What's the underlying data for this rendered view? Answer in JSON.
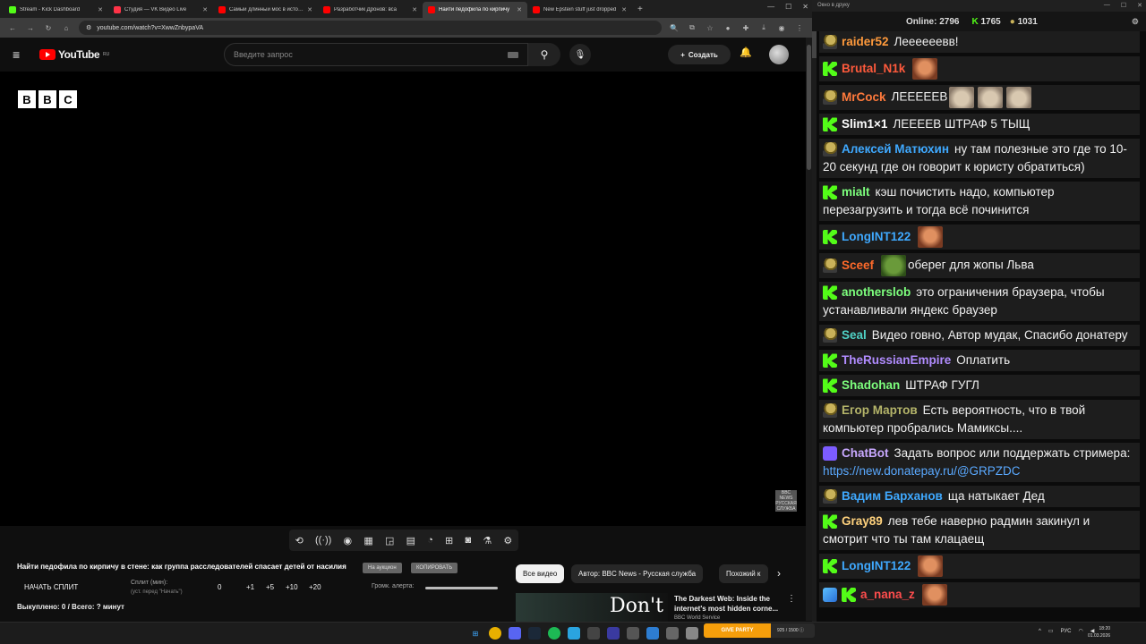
{
  "browser": {
    "tabs": [
      {
        "title": "Stream - Kick Dashboard",
        "color": "#53fc18",
        "active": false
      },
      {
        "title": "Студия — VK Видео Live",
        "color": "#ff3347",
        "active": false
      },
      {
        "title": "Самый длинный мос в истори",
        "color": "#ff0000",
        "active": false
      },
      {
        "title": "Разработчик Дронов: вса",
        "color": "#ff0000",
        "active": false
      },
      {
        "title": "Найти педофила по кирпичу",
        "color": "#ff0000",
        "active": true
      },
      {
        "title": "New Epstein stuff just dropped",
        "color": "#ff0000",
        "active": false
      }
    ],
    "url": "youtube.com/watch?v=XwwZnbypaVA"
  },
  "youtube": {
    "logo_text": "YouTube",
    "region": "RU",
    "search_placeholder": "Введите запрос",
    "create_label": "Создать",
    "video_title": "Найти педофила по кирпичу в стене: как группа расследователей спасает детей от насилия",
    "chip_1": "На аукцион",
    "chip_2": "КОПИРОВАТЬ",
    "bbc_letters": [
      "B",
      "B",
      "C"
    ],
    "watermark": "BBC NEWS РУССКАЯ СЛУЖБА"
  },
  "split": {
    "start_label": "НАЧАТЬ СПЛИТ",
    "min_label": "Сплит (мин):",
    "hint": "(уст. перед \"Начать\")",
    "value": "0",
    "steps": [
      "+1",
      "+5",
      "+10",
      "+20"
    ],
    "alert_label": "Громк. алерта:",
    "bought": "Выкуплено: 0 / Всего: ? минут"
  },
  "related": {
    "chips": [
      "Все видео",
      "Автор: BBC News - Русская служба",
      "Похожий к"
    ],
    "thumb_text": "Don't",
    "title": "The Darkest Web: Inside the internet's most hidden corne...",
    "channel": "BBC World Service"
  },
  "chat": {
    "window_title": "Окно в друку",
    "online_label": "Online:",
    "online": "2796",
    "kick_count": "1765",
    "other_count": "1031",
    "messages": [
      {
        "icon": "d",
        "user": "raider52",
        "color": "#ff9a3c",
        "text": "Леееееевв!"
      },
      {
        "icon": "k",
        "user": "Brutal_N1k",
        "color": "#ff5a3c",
        "text": "",
        "emotes": [
          "e-face"
        ]
      },
      {
        "icon": "d",
        "user": "MrCock",
        "color": "#ff7a3c",
        "text": "ЛЕЕЕЕЕВ",
        "emotes": [
          "e-cat",
          "e-cat",
          "e-cat"
        ]
      },
      {
        "icon": "k",
        "user": "Slim1×1",
        "color": "#ffffff",
        "text": "ЛЕЕЕЕВ ШТРАФ 5 ТЫЩ"
      },
      {
        "icon": "d",
        "user": "Алексей Матюхин",
        "color": "#3fa9ff",
        "text": "ну там полезные это где то 10-20 секунд где он говорит к юристу обратиться)"
      },
      {
        "icon": "k",
        "user": "mialt",
        "color": "#7dff7d",
        "text": "кэш почистить надо, компьютер перезагрузить и тогда всё починится"
      },
      {
        "icon": "k",
        "user": "LongINT122",
        "color": "#3fa9ff",
        "text": "",
        "emotes": [
          "e-face"
        ]
      },
      {
        "icon": "d",
        "user": "Sceef",
        "color": "#ff6a2a",
        "text": "оберег для жопы Льва",
        "emotes": [
          "e-frog"
        ]
      },
      {
        "icon": "k",
        "user": "anotherslob",
        "color": "#7dff7d",
        "text": "это ограничения браузера, чтобы устанавливали яндекс браузер"
      },
      {
        "icon": "d",
        "user": "Seal",
        "color": "#4fd1c5",
        "text": "Видео говно, Автор мудак, Спасибо донатеру"
      },
      {
        "icon": "k",
        "user": "TheRussianEmpire",
        "color": "#b18cff",
        "text": "Оплатить"
      },
      {
        "icon": "k",
        "user": "Shadohan",
        "color": "#7dff7d",
        "text": "ШТРАФ ГУГЛ"
      },
      {
        "icon": "d",
        "user": "Егор Мартов",
        "color": "#b5b56a",
        "text": "Есть вероятность, что в твой компьютер пробрались Мамиксы...."
      },
      {
        "icon": "r",
        "user": "ChatBot",
        "color": "#c8a8ff",
        "text": "Задать вопрос или поддержать стримера:",
        "link": "https://new.donatepay.ru/@GRPZDC"
      },
      {
        "icon": "d",
        "user": "Вадим Барханов",
        "color": "#3fa9ff",
        "text": "ща натыкает Дед"
      },
      {
        "icon": "k",
        "user": "Gray89",
        "color": "#ffd27d",
        "text": "лев тебе наверно радмин закинул и смотрит что ты там клацаещ"
      },
      {
        "icon": "k",
        "user": "LongINT122",
        "color": "#3fa9ff",
        "text": "",
        "emotes": [
          "e-face"
        ]
      },
      {
        "icon": "k",
        "user": "a_nana_z",
        "color": "#ff4d4d",
        "text": "",
        "emotes": [
          "e-face"
        ],
        "extra_icon": "s"
      }
    ]
  },
  "taskbar": {
    "obs_label": "GIVE PARTY",
    "obs_count": "925 / 1500 ⓘ",
    "lang": "РУС",
    "time": "18:20",
    "date": "01.03.2026"
  }
}
